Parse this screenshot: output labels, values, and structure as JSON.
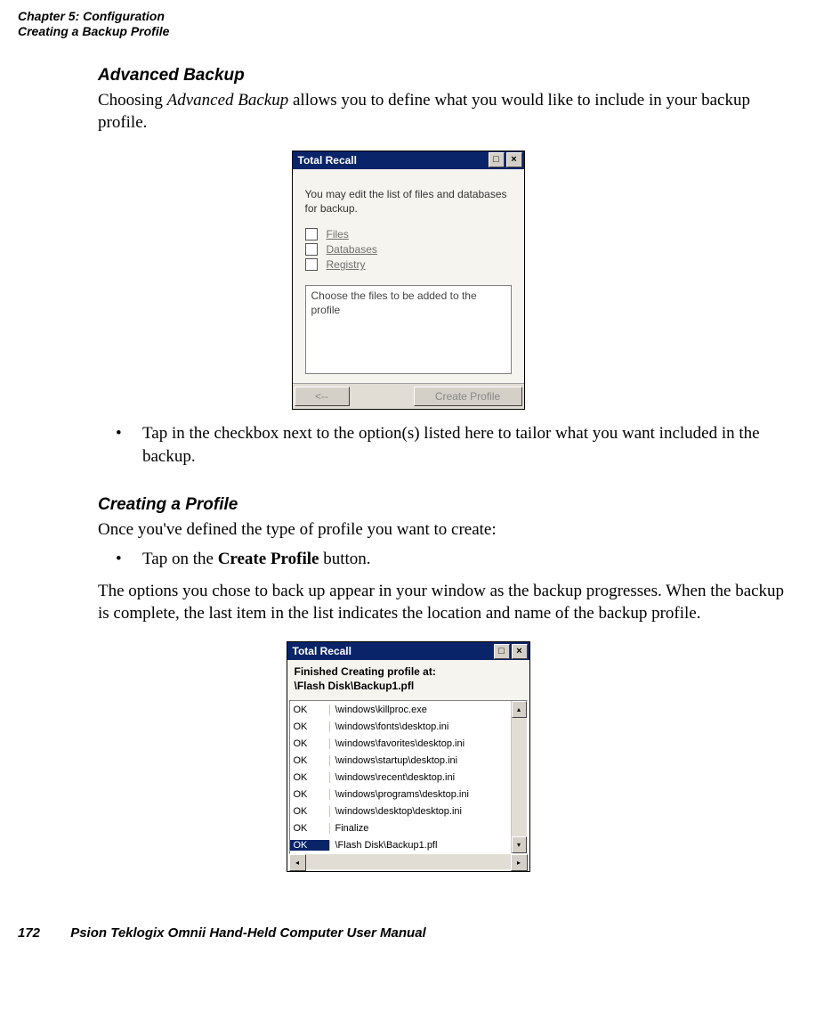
{
  "header": {
    "chapter_line": "Chapter 5:  Configuration",
    "section_line": "Creating a Backup Profile"
  },
  "sec1": {
    "title": "Advanced Backup",
    "para": "Choosing Advanced Backup allows you to define what you would like to include in your backup profile.",
    "para_prefix": "Choosing ",
    "para_italic": "Advanced Backup",
    "para_suffix": " allows you to define what you would like to include in your backup profile."
  },
  "fig1": {
    "title": "Total Recall",
    "hint": "You may edit the list of files and databases for backup.",
    "options": [
      "Files",
      "Databases",
      "Registry"
    ],
    "msg": "Choose the files to be added to the profile",
    "back_label": "<--",
    "create_label": "Create Profile"
  },
  "bullet1": "Tap in the checkbox next to the option(s) listed here to tailor what you want included in the backup.",
  "sec2": {
    "title": "Creating a Profile",
    "para1": "Once you've defined the type of profile you want to create:",
    "bullet_prefix": "Tap on the ",
    "bullet_bold": "Create Profile",
    "bullet_suffix": " button.",
    "para2": "The options you chose to back up appear in your window as the backup progresses. When the backup is complete, the last item in the list indicates the location and name of the backup profile."
  },
  "fig2": {
    "title": "Total Recall",
    "finished_line1": "Finished Creating profile at:",
    "finished_line2": "\\Flash Disk\\Backup1.pfl",
    "rows": [
      {
        "status": "OK",
        "path": "\\windows\\killproc.exe"
      },
      {
        "status": "OK",
        "path": "\\windows\\fonts\\desktop.ini"
      },
      {
        "status": "OK",
        "path": "\\windows\\favorites\\desktop.ini"
      },
      {
        "status": "OK",
        "path": "\\windows\\startup\\desktop.ini"
      },
      {
        "status": "OK",
        "path": "\\windows\\recent\\desktop.ini"
      },
      {
        "status": "OK",
        "path": "\\windows\\programs\\desktop.ini"
      },
      {
        "status": "OK",
        "path": "\\windows\\desktop\\desktop.ini"
      },
      {
        "status": "OK",
        "path": "Finalize"
      },
      {
        "status": "OK",
        "path": "\\Flash Disk\\Backup1.pfl",
        "selected": true
      }
    ]
  },
  "footer": {
    "page": "172",
    "text": "Psion Teklogix Omnii Hand-Held Computer User Manual"
  },
  "glyphs": {
    "max": "□",
    "close": "×",
    "up": "▴",
    "down": "▾",
    "left": "◂",
    "right": "▸",
    "bullet": "•"
  }
}
